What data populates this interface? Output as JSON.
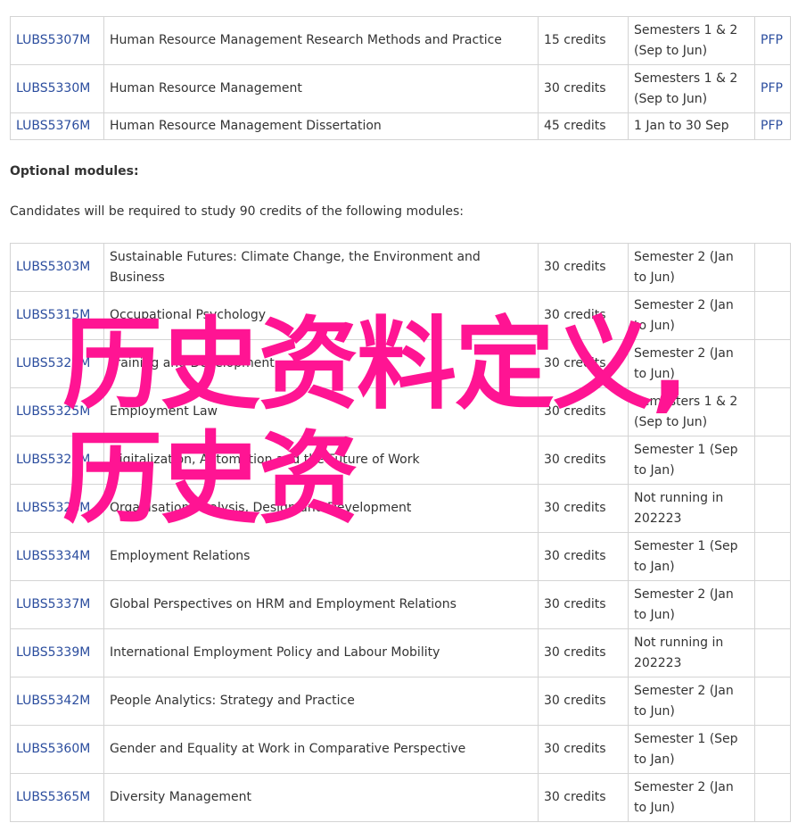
{
  "required_modules": [
    {
      "code": "LUBS5307M",
      "title": "Human Resource Management Research Methods and Practice",
      "credits": "15 credits",
      "semester": "Semesters 1 & 2 (Sep to Jun)",
      "pfp": "PFP"
    },
    {
      "code": "LUBS5330M",
      "title": "Human Resource Management",
      "credits": "30 credits",
      "semester": "Semesters 1 & 2 (Sep to Jun)",
      "pfp": "PFP"
    },
    {
      "code": "LUBS5376M",
      "title": "Human Resource Management Dissertation",
      "credits": "45 credits",
      "semester": "1 Jan to 30 Sep",
      "pfp": "PFP"
    }
  ],
  "optional_heading": "Optional modules:",
  "optional_intro": "Candidates will be required to study 90 credits of the following modules:",
  "optional_modules": [
    {
      "code": "LUBS5303M",
      "title": "Sustainable Futures: Climate Change, the Environment and Business",
      "credits": "30 credits",
      "semester": "Semester 2 (Jan to Jun)"
    },
    {
      "code": "LUBS5315M",
      "title": "Occupational Psychology",
      "credits": "30 credits",
      "semester": "Semester 2 (Jan to Jun)"
    },
    {
      "code": "LUBS5320M",
      "title": "Training and Development",
      "credits": "30 credits",
      "semester": "Semester 2 (Jan to Jun)"
    },
    {
      "code": "LUBS5325M",
      "title": "Employment Law",
      "credits": "30 credits",
      "semester": "Semesters 1 & 2 (Sep to Jun)"
    },
    {
      "code": "LUBS5326M",
      "title": "Digitalization, Automation and the Future of Work",
      "credits": "30 credits",
      "semester": "Semester 1 (Sep to Jan)"
    },
    {
      "code": "LUBS5328M",
      "title": "Organisation Analysis, Design and Development",
      "credits": "30 credits",
      "semester": "Not running in 202223"
    },
    {
      "code": "LUBS5334M",
      "title": "Employment Relations",
      "credits": "30 credits",
      "semester": "Semester 1 (Sep to Jan)"
    },
    {
      "code": "LUBS5337M",
      "title": "Global Perspectives on HRM and Employment Relations",
      "credits": "30 credits",
      "semester": "Semester 2 (Jan to Jun)"
    },
    {
      "code": "LUBS5339M",
      "title": "International Employment Policy and Labour Mobility",
      "credits": "30 credits",
      "semester": "Not running in 202223"
    },
    {
      "code": "LUBS5342M",
      "title": "People Analytics: Strategy and Practice",
      "credits": "30 credits",
      "semester": "Semester 2 (Jan to Jun)"
    },
    {
      "code": "LUBS5360M",
      "title": "Gender and Equality at Work in Comparative Perspective",
      "credits": "30 credits",
      "semester": "Semester 1 (Sep to Jan)"
    },
    {
      "code": "LUBS5365M",
      "title": "Diversity Management",
      "credits": "30 credits",
      "semester": "Semester 2 (Jan to Jun)"
    }
  ],
  "watermark_text": "历史资料定义,历史资"
}
